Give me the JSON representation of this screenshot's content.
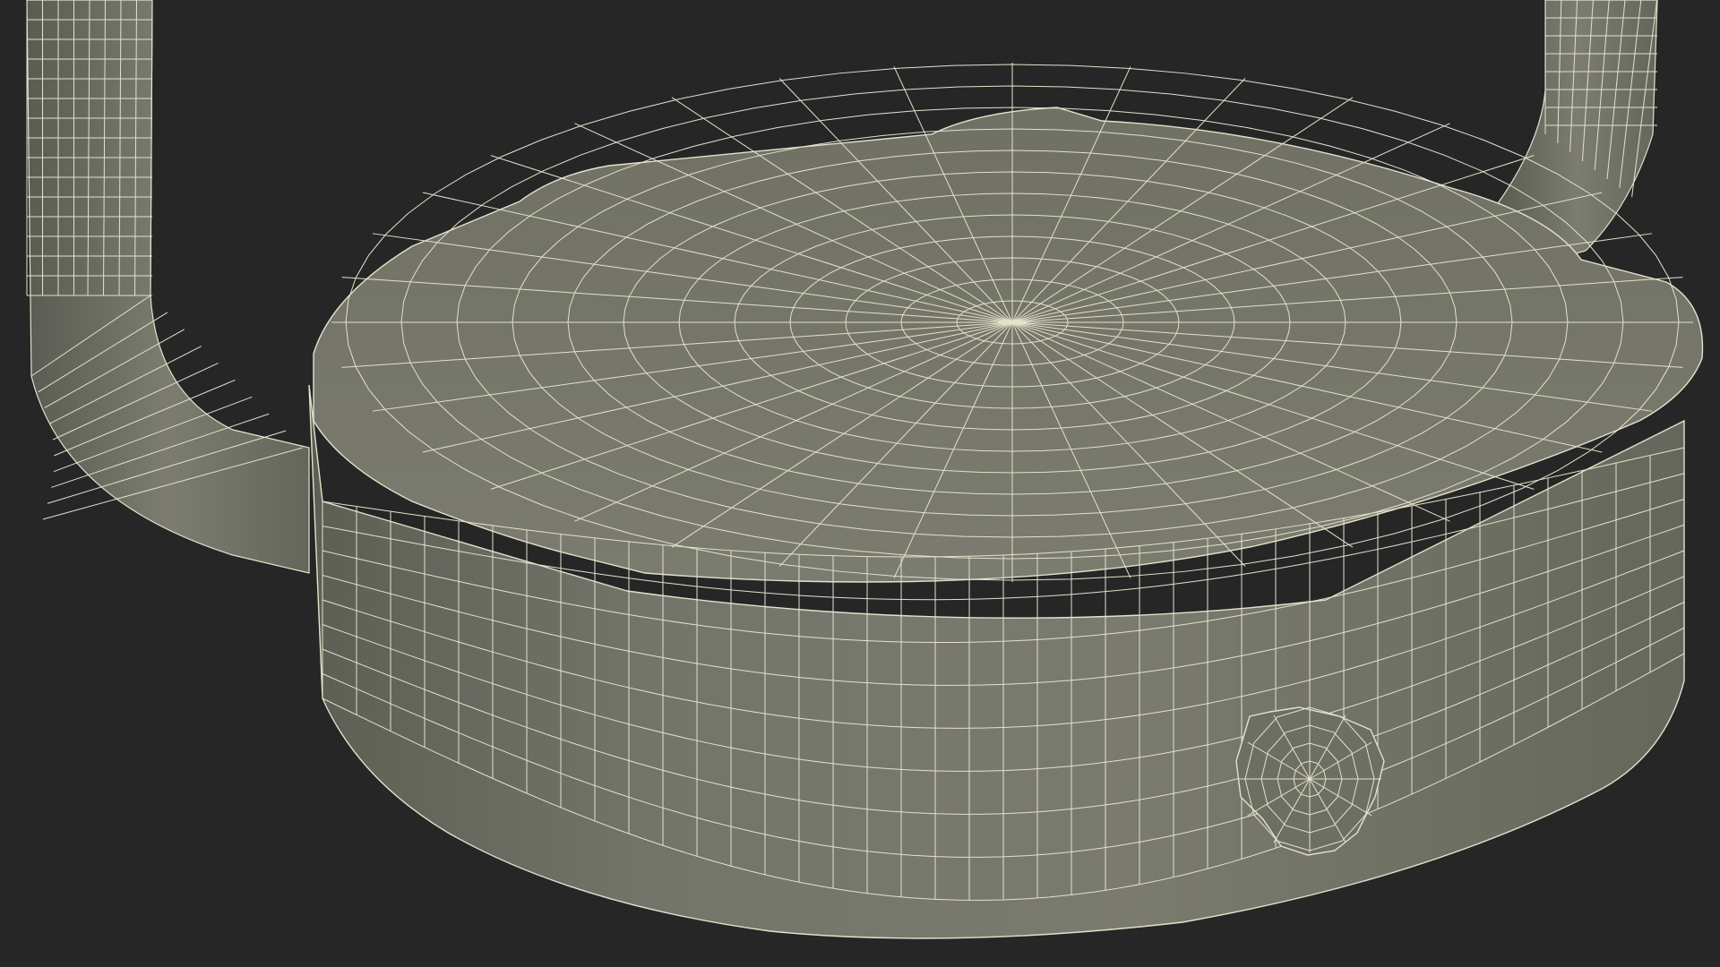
{
  "scene": {
    "subject": "wireframe-render",
    "colors": {
      "background": "#262626",
      "surface": "#777869",
      "surface_shade": "#6b6c5f",
      "surface_dark": "#5f6055",
      "wire": "#e4e1cc",
      "silhouette": "#1c1c1c"
    }
  }
}
